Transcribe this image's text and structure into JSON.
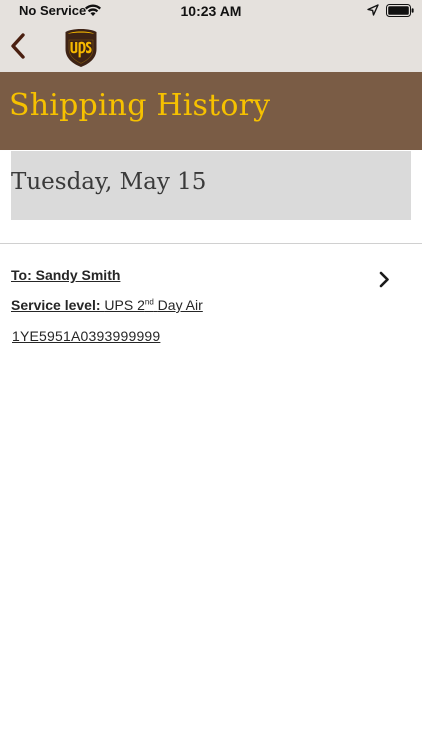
{
  "status_bar": {
    "carrier": "No Service",
    "time": "10:23 AM"
  },
  "icons": {
    "back": "chevron-left-icon",
    "logo": "ups-shield-logo",
    "wifi": "wifi-icon",
    "location": "location-arrow-icon",
    "battery": "battery-icon",
    "row_chevron": "chevron-right-icon"
  },
  "colors": {
    "nav_bar": "#e5e1dd",
    "banner": "#7a5c45",
    "banner_text": "#f6c100",
    "date_box": "#dadada",
    "back_icon": "#4a1f10"
  },
  "page": {
    "title": "Shipping History"
  },
  "date_header": "Tuesday, May 15",
  "shipment": {
    "to_label": "To: Sandy Smith",
    "service_label": "Service level:",
    "service_value_prefix": "UPS 2",
    "service_value_sup": "nd",
    "service_value_suffix": "Day Air",
    "tracking_number": "1YE5951A0393999999"
  }
}
